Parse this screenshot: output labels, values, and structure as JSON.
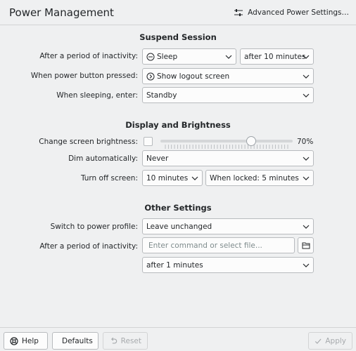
{
  "header": {
    "title": "Power Management",
    "advanced_label": "Advanced Power Settings…"
  },
  "suspend": {
    "title": "Suspend Session",
    "inactivity_label": "After a period of inactivity:",
    "inactivity_action": "Sleep",
    "inactivity_time": "after 10 minutes",
    "power_button_label": "When power button pressed:",
    "power_button_action": "Show logout screen",
    "sleeping_label": "When sleeping, enter:",
    "sleeping_mode": "Standby"
  },
  "display": {
    "title": "Display and Brightness",
    "brightness_label": "Change screen brightness:",
    "brightness_checked": false,
    "brightness_value": 70,
    "brightness_text": "70%",
    "dim_label": "Dim automatically:",
    "dim_value": "Never",
    "turnoff_label": "Turn off screen:",
    "turnoff_value": "10 minutes",
    "turnoff_locked_value": "When locked: 5 minutes"
  },
  "other": {
    "title": "Other Settings",
    "profile_label": "Switch to power profile:",
    "profile_value": "Leave unchanged",
    "command_label": "After a period of inactivity:",
    "command_placeholder": "Enter command or select file...",
    "command_time": "after 1 minutes"
  },
  "footer": {
    "help": "Help",
    "defaults": "Defaults",
    "reset": "Reset",
    "apply": "Apply"
  },
  "colors": {
    "background": "#eff0f1",
    "field": "#fcfcfc",
    "border": "#b8bbbe",
    "text": "#232629",
    "disabled_text": "#a7aaad"
  }
}
